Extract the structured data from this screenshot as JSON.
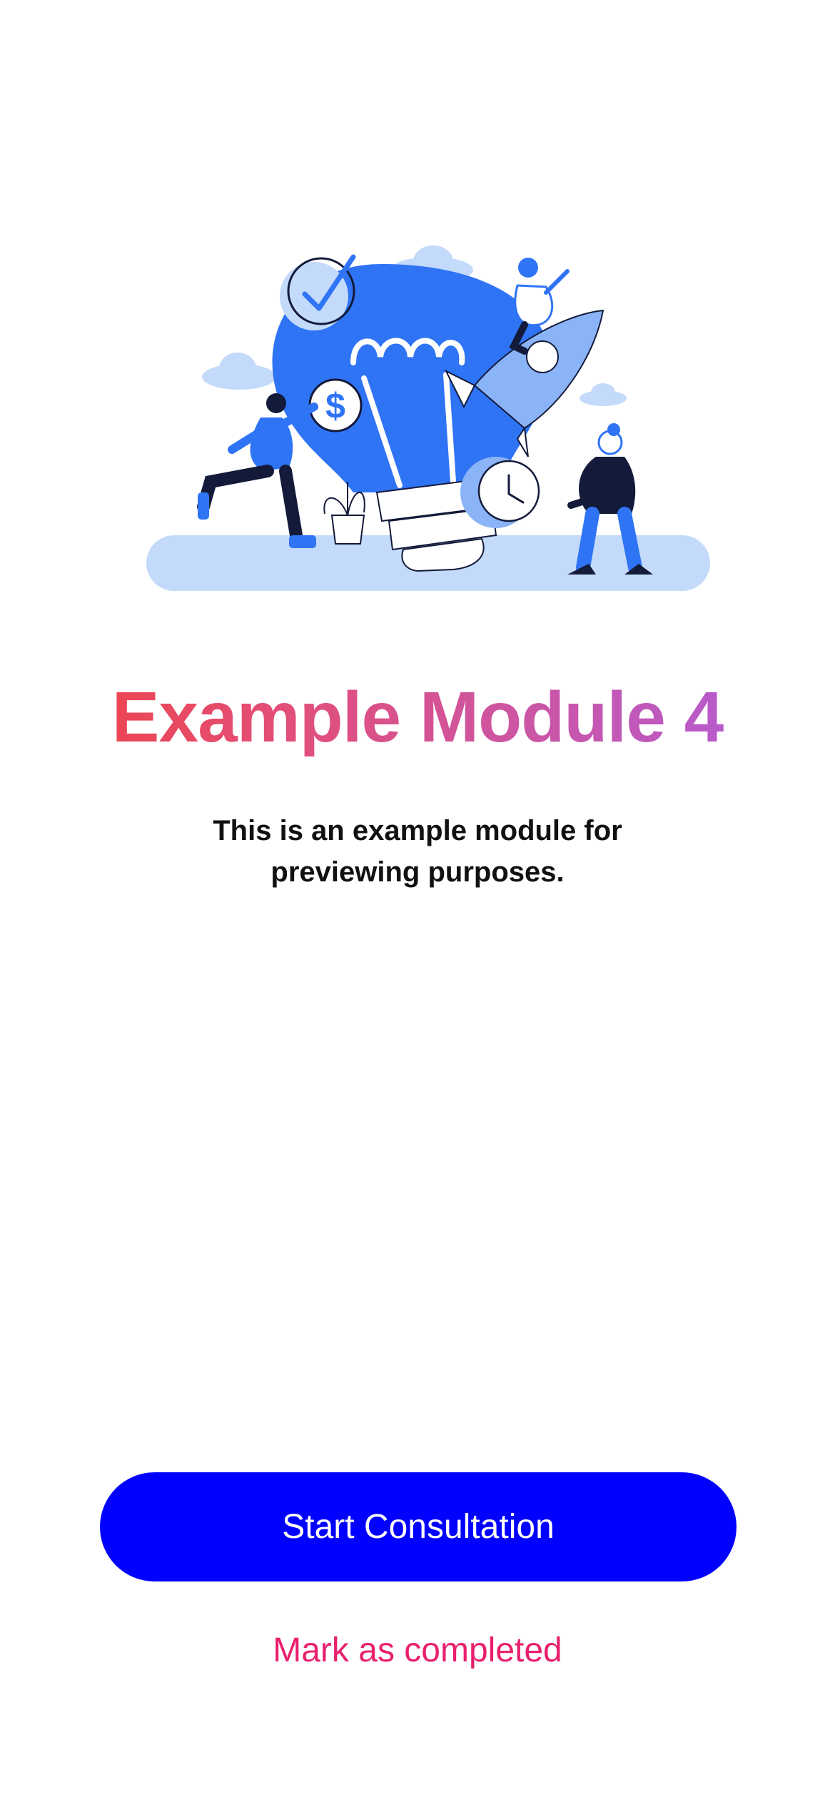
{
  "illustration": {
    "icon": "lightbulb-ideas-illustration",
    "colors": {
      "primary_blue": "#2f74f5",
      "light_blue": "#c4dafa",
      "dark_navy": "#131a3a"
    }
  },
  "module": {
    "title": "Example Module 4",
    "description": "This is an example module for previewing purposes.",
    "title_gradient": [
      "#f2403d",
      "#ac5de0"
    ]
  },
  "actions": {
    "primary_label": "Start Consultation",
    "primary_color": "#0000ff",
    "secondary_label": "Mark as completed",
    "secondary_color": "#e8206e"
  }
}
